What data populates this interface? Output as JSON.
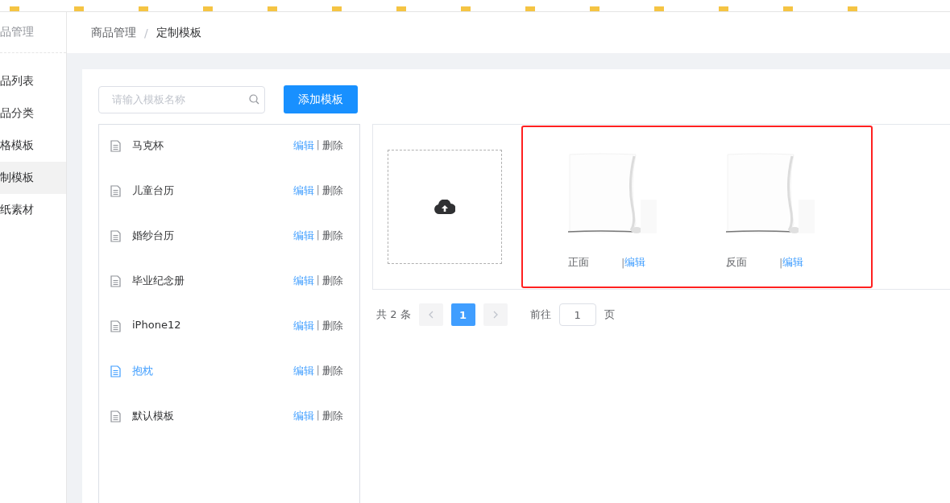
{
  "sidebar": {
    "title": "品管理",
    "items": [
      {
        "label": "品列表",
        "selected": false
      },
      {
        "label": "品分类",
        "selected": false
      },
      {
        "label": "格模板",
        "selected": false
      },
      {
        "label": "制模板",
        "selected": true
      },
      {
        "label": "纸素材",
        "selected": false
      }
    ]
  },
  "breadcrumb": [
    "商品管理",
    "定制模板"
  ],
  "breadcrumb_separator": "/",
  "search": {
    "placeholder": "请输入模板名称"
  },
  "add_button": "添加模板",
  "templates": [
    {
      "name": "马克杯",
      "selected": false,
      "edit": "编辑",
      "separator": "|",
      "delete": "删除"
    },
    {
      "name": "儿童台历",
      "selected": false,
      "edit": "编辑",
      "separator": "|",
      "delete": "删除"
    },
    {
      "name": "婚纱台历",
      "selected": false,
      "edit": "编辑",
      "separator": "|",
      "delete": "删除"
    },
    {
      "name": "毕业纪念册",
      "selected": false,
      "edit": "编辑",
      "separator": "|",
      "delete": "删除"
    },
    {
      "name": "iPhone12",
      "selected": false,
      "edit": "编辑",
      "separator": "|",
      "delete": "删除"
    },
    {
      "name": "抱枕",
      "selected": true,
      "edit": "编辑",
      "separator": "|",
      "delete": "删除"
    },
    {
      "name": "默认模板",
      "selected": false,
      "edit": "编辑",
      "separator": "|",
      "delete": "删除"
    }
  ],
  "sides": [
    {
      "label": "正面",
      "separator": "|",
      "edit": "编辑",
      "kind": "picture"
    },
    {
      "label": "反面",
      "separator": "|",
      "edit": "编辑",
      "kind": "picture"
    }
  ],
  "pagination": {
    "total": "共 2 条",
    "pages": [
      {
        "label": "1",
        "selected": true
      }
    ],
    "goto_label": "前往",
    "goto_value": "1",
    "page_suffix": "页"
  }
}
